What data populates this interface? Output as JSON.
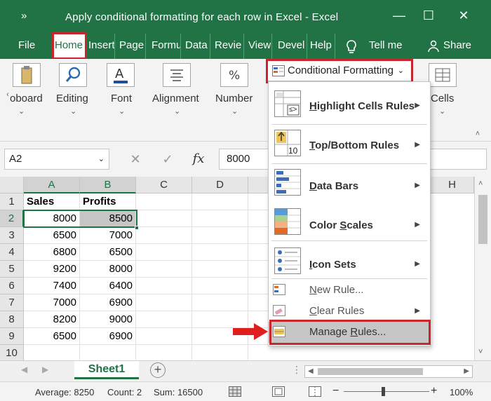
{
  "window": {
    "title": "Apply conditional formatting for each row in Excel  -  Excel",
    "qat_symbol": "»",
    "controls": {
      "minimize": "—",
      "maximize": "☐",
      "close": "✕"
    }
  },
  "tabs": [
    {
      "label": "File"
    },
    {
      "label": "Home"
    },
    {
      "label": "Insert"
    },
    {
      "label": "Page"
    },
    {
      "label": "Formu"
    },
    {
      "label": "Data"
    },
    {
      "label": "Revie"
    },
    {
      "label": "View"
    },
    {
      "label": "Devel"
    },
    {
      "label": "Help"
    },
    {
      "label": "Tell me"
    },
    {
      "label": "Share"
    }
  ],
  "ribbon": {
    "groups": [
      {
        "label": "oboard"
      },
      {
        "label": "Editing"
      },
      {
        "label": "Font"
      },
      {
        "label": "Alignment"
      },
      {
        "label": "Number"
      },
      {
        "label": "Cells"
      }
    ],
    "conditional_formatting": "Conditional Formatting",
    "chevron": "⌄"
  },
  "formula_bar": {
    "name_box": "A2",
    "cancel": "✕",
    "enter": "✓",
    "fx": "fx",
    "value": "8000"
  },
  "grid": {
    "columns": [
      "A",
      "B",
      "C",
      "D",
      "H"
    ],
    "rows": [
      "1",
      "2",
      "3",
      "4",
      "5",
      "6",
      "7",
      "8",
      "9",
      "10"
    ],
    "headers": [
      "Sales",
      "Profits"
    ],
    "data": [
      [
        "8000",
        "8500"
      ],
      [
        "6500",
        "7000"
      ],
      [
        "6800",
        "6500"
      ],
      [
        "9200",
        "8000"
      ],
      [
        "7400",
        "6400"
      ],
      [
        "7000",
        "6900"
      ],
      [
        "8200",
        "9000"
      ],
      [
        "6500",
        "6900"
      ]
    ]
  },
  "menu": {
    "big_items": [
      {
        "pre": "",
        "accel": "H",
        "post": "ighlight Cells Rules"
      },
      {
        "pre": "",
        "accel": "T",
        "post": "op/Bottom Rules"
      },
      {
        "pre": "",
        "accel": "D",
        "post": "ata Bars"
      },
      {
        "pre": "Color ",
        "accel": "S",
        "post": "cales"
      },
      {
        "pre": "",
        "accel": "I",
        "post": "con Sets"
      }
    ],
    "small_items": [
      {
        "pre": "",
        "accel": "N",
        "post": "ew Rule..."
      },
      {
        "pre": "",
        "accel": "C",
        "post": "lear Rules"
      },
      {
        "pre": "Manage ",
        "accel": "R",
        "post": "ules..."
      }
    ],
    "icon_number": "10",
    "icon_symbol": "≤>"
  },
  "sheet": {
    "tab": "Sheet1",
    "add": "+"
  },
  "status": {
    "average": "Average: 8250",
    "count": "Count: 2",
    "sum": "Sum: 16500",
    "zoom": "100%",
    "zoom_minus": "−",
    "zoom_plus": "+"
  },
  "colors": {
    "excel_green": "#217346",
    "highlight_red": "#c8262a",
    "selection_gray": "#c6c6c6"
  }
}
